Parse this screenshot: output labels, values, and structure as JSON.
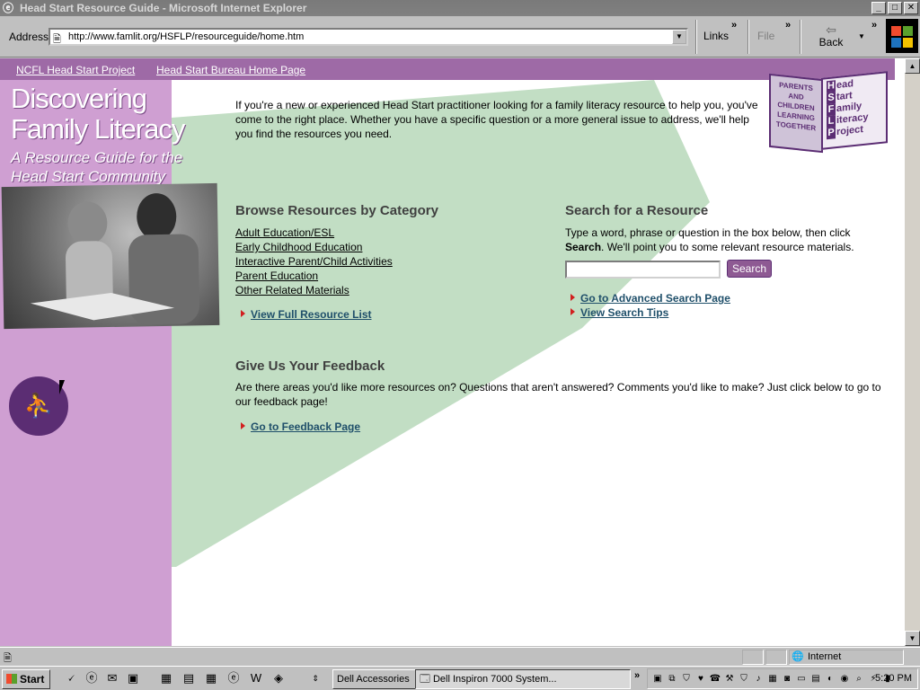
{
  "window": {
    "title": "Head Start Resource Guide - Microsoft Internet Explorer",
    "buttons": {
      "minimize": "_",
      "maximize": "□",
      "close": "✕"
    }
  },
  "toolbar": {
    "address_label": "Address",
    "url": "http://www.famlit.org/HSFLP/resourceguide/home.htm",
    "links_label": "Links",
    "file_label": "File",
    "back_label": "Back",
    "chevron": "»"
  },
  "page": {
    "nav": {
      "link1": "NCFL Head Start Project",
      "link2": "Head Start Bureau Home Page"
    },
    "banner": {
      "title_line1": "Discovering",
      "title_line2": "Family Literacy",
      "subtitle_line1": "A Resource Guide for the",
      "subtitle_line2": "Head Start Community"
    },
    "logo": {
      "left_lines": [
        "PARENTS",
        "AND",
        "CHILDREN",
        "LEARNING",
        "TOGETHER"
      ],
      "right_lines": [
        {
          "initial": "H",
          "rest": "ead"
        },
        {
          "initial": "S",
          "rest": "tart"
        },
        {
          "initial": "F",
          "rest": "amily"
        },
        {
          "initial": "L",
          "rest": "iteracy"
        },
        {
          "initial": "P",
          "rest": "roject"
        }
      ]
    },
    "intro": "If you're a new or experienced Head Start practitioner looking for a family literacy resource to help you, you've come to the right place. Whether you have a specific question or a more general issue to address, we'll help you find the resources you need.",
    "browse": {
      "heading": "Browse Resources by Category",
      "categories": [
        "Adult Education/ESL",
        "Early Childhood Education",
        "Interactive Parent/Child Activities",
        "Parent Education",
        "Other Related Materials"
      ],
      "full_list_link": "View Full Resource List"
    },
    "search": {
      "heading": "Search for a Resource",
      "desc_before": "Type a word, phrase or question in the box below, then click ",
      "desc_bold": "Search",
      "desc_after": ". We'll point you to some relevant resource materials.",
      "input_value": "",
      "button": "Search",
      "advanced_link": "Go to Advanced Search Page",
      "tips_link": "View Search Tips"
    },
    "feedback": {
      "heading": "Give Us Your Feedback",
      "text": "Are there areas you'd like more resources on? Questions that aren't answered? Comments you'd like to make? Just click below to go to our feedback page!",
      "link": "Go to Feedback Page"
    }
  },
  "statusbar": {
    "zone": "Internet"
  },
  "taskbar": {
    "start": "Start",
    "tasks": [
      "Dell Accessories",
      "Dell Inspiron 7000 System..."
    ],
    "clock": "5:20 PM"
  },
  "colors": {
    "nav_purple": "#9e6aa6",
    "left_purple": "#cf9fd2",
    "green_shape": "#c2dec4",
    "link_blue": "#1f4f6a",
    "arrow_red": "#d21f1f"
  }
}
